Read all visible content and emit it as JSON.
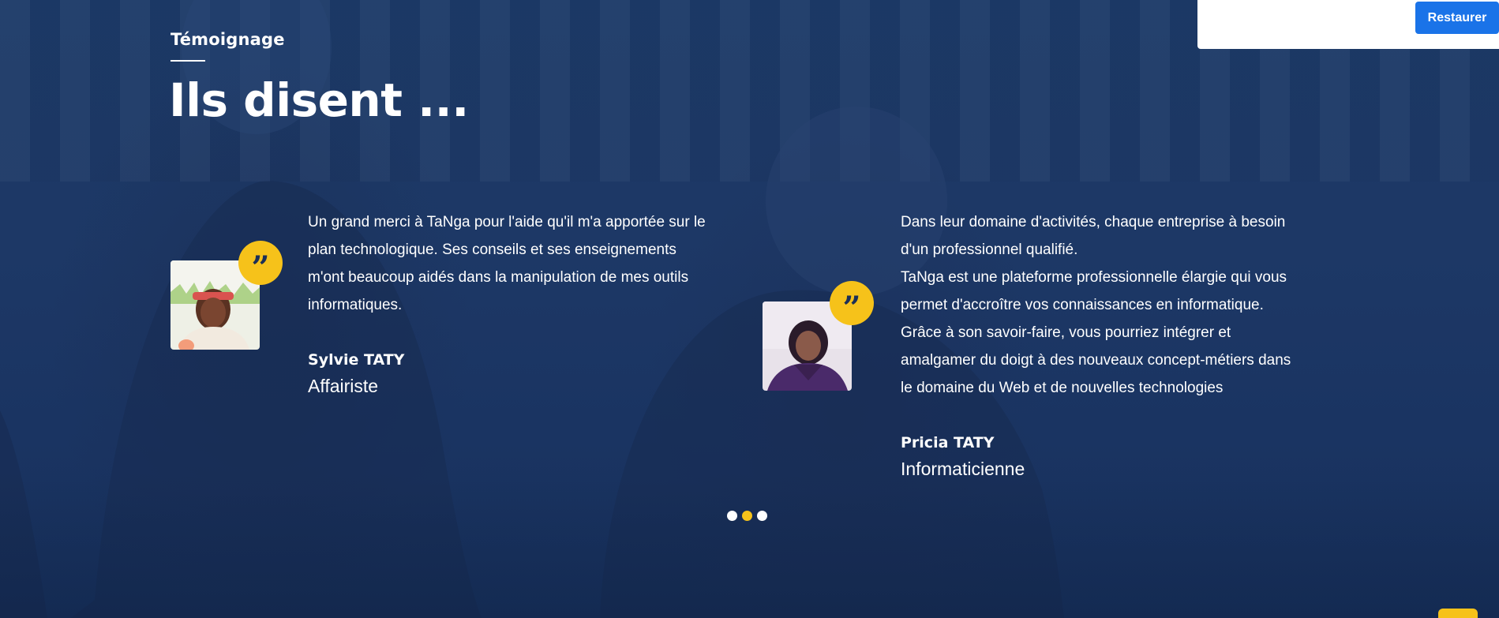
{
  "section": {
    "eyebrow": "Témoignage",
    "heading": "Ils disent ..."
  },
  "testimonials": [
    {
      "text_lines": [
        "Un grand merci à TaNga pour l'aide qu'il m'a apportée sur le",
        "plan technologique. Ses conseils et ses enseignements",
        "m'ont beaucoup aidés dans la manipulation de mes outils",
        "informatiques."
      ],
      "name": "Sylvie TATY",
      "role": "Affairiste",
      "quote_glyph": "”"
    },
    {
      "text_lines": [
        "Dans leur domaine d'activités, chaque entreprise à besoin",
        "d'un professionnel qualifié.",
        "TaNga est une plateforme professionnelle élargie qui vous",
        "permet d'accroître vos connaissances en informatique.",
        "Grâce à son savoir-faire, vous pourriez intégrer et",
        "amalgamer du doigt à des nouveaux concept-métiers dans",
        "le domaine du Web et de nouvelles technologies"
      ],
      "name": "Pricia TATY",
      "role": "Informaticienne",
      "quote_glyph": "”"
    }
  ],
  "carousel": {
    "dot_count": 3,
    "active_index": 1
  },
  "restore": {
    "label": "Restaurer"
  },
  "colors": {
    "overlay": "#1c3a68",
    "accent": "#f6c21a",
    "button": "#1a73e8",
    "text": "#ffffff"
  }
}
